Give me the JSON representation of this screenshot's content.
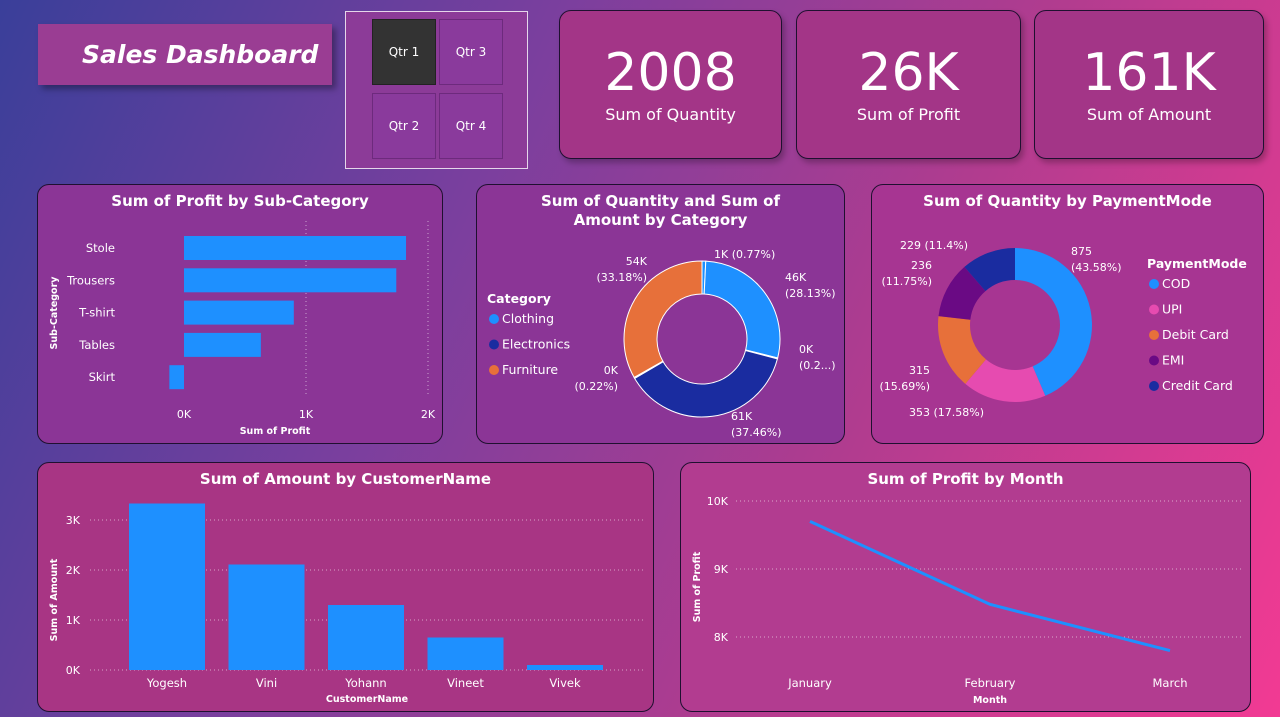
{
  "header": {
    "title": "Sales Dashboard"
  },
  "slicer": {
    "items": [
      "Qtr 1",
      "Qtr 3",
      "Qtr 2",
      "Qtr 4"
    ],
    "selected": "Qtr 1"
  },
  "kpis": [
    {
      "value": "2008",
      "label": "Sum of Quantity"
    },
    {
      "value": "26K",
      "label": "Sum of Profit"
    },
    {
      "value": "161K",
      "label": "Sum of Amount"
    }
  ],
  "colors": {
    "bar": "#1e90ff",
    "clothing": "#1e90ff",
    "electronics": "#1a2ca0",
    "furniture": "#e7703a",
    "cod": "#1e90ff",
    "upi": "#e64bb0",
    "debit": "#e7703a",
    "emi": "#6a0a84",
    "credit": "#1a2ca0"
  },
  "chart_data": [
    {
      "id": "profit_by_subcategory",
      "type": "bar",
      "orientation": "horizontal",
      "title": "Sum of Profit by Sub-Category",
      "xlabel": "Sum of Profit",
      "ylabel": "Sub-Category",
      "categories": [
        "Stole",
        "Trousers",
        "T-shirt",
        "Tables",
        "Skirt"
      ],
      "values": [
        1820,
        1740,
        900,
        630,
        -120
      ],
      "xlim": [
        -200,
        2000
      ],
      "xticks": [
        "0K",
        "1K",
        "2K"
      ],
      "xtick_values": [
        0,
        1000,
        2000
      ]
    },
    {
      "id": "qty_amount_by_category",
      "type": "pie",
      "donut": true,
      "title": "Sum of Quantity and Sum of Amount by Category",
      "legend_title": "Category",
      "legend": [
        "Clothing",
        "Electronics",
        "Furniture"
      ],
      "slices": [
        {
          "category": "Clothing",
          "value": 0.77,
          "label": "1K (0.77%)"
        },
        {
          "category": "Clothing",
          "value": 28.13,
          "label": "46K (28.13%)"
        },
        {
          "category": "Clothing",
          "value": 0.2,
          "label": "0K (0.2...)"
        },
        {
          "category": "Electronics",
          "value": 37.46,
          "label": "61K (37.46%)"
        },
        {
          "category": "Electronics",
          "value": 0.22,
          "label": "0K (0.22%)"
        },
        {
          "category": "Furniture",
          "value": 33.18,
          "label": "54K (33.18%)"
        }
      ]
    },
    {
      "id": "qty_by_paymentmode",
      "type": "pie",
      "donut": true,
      "title": "Sum of Quantity by PaymentMode",
      "legend_title": "PaymentMode",
      "legend": [
        "COD",
        "UPI",
        "Debit Card",
        "EMI",
        "Credit Card"
      ],
      "slices": [
        {
          "category": "COD",
          "value": 875,
          "label": "875 (43.58%)"
        },
        {
          "category": "UPI",
          "value": 353,
          "label": "353 (17.58%)"
        },
        {
          "category": "Debit Card",
          "value": 315,
          "label": "315 (15.69%)"
        },
        {
          "category": "EMI",
          "value": 236,
          "label": "236 (11.75%)"
        },
        {
          "category": "Credit Card",
          "value": 229,
          "label": "229 (11.4%)"
        }
      ]
    },
    {
      "id": "amount_by_customer",
      "type": "bar",
      "title": "Sum of Amount by CustomerName",
      "xlabel": "CustomerName",
      "ylabel": "Sum of Amount",
      "categories": [
        "Yogesh",
        "Vini",
        "Yohann",
        "Vineet",
        "Vivek"
      ],
      "values": [
        3330,
        2110,
        1300,
        650,
        100
      ],
      "ylim": [
        0,
        3500
      ],
      "yticks": [
        "0K",
        "1K",
        "2K",
        "3K"
      ],
      "ytick_values": [
        0,
        1000,
        2000,
        3000
      ]
    },
    {
      "id": "profit_by_month",
      "type": "line",
      "title": "Sum of Profit by Month",
      "xlabel": "Month",
      "ylabel": "Sum of Profit",
      "categories": [
        "January",
        "February",
        "March"
      ],
      "values": [
        9700,
        8480,
        7800
      ],
      "ylim": [
        7800,
        10000
      ],
      "yticks": [
        "8K",
        "9K",
        "10K"
      ],
      "ytick_values": [
        8000,
        9000,
        10000
      ]
    }
  ]
}
